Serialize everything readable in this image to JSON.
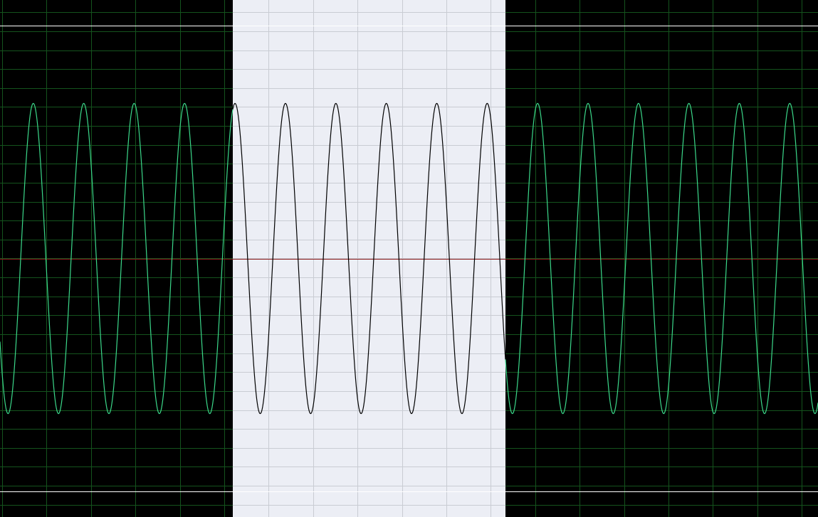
{
  "waveform_view": {
    "background_color": "#000000",
    "grid_color": "#14531d",
    "waveform_color": "#3bd88a",
    "center_line_color": "#8b1a1a",
    "clip_line_color": "#ffffff",
    "selection": {
      "start_fraction": 0.285,
      "end_fraction": 0.618,
      "background_color": "#eceef5",
      "grid_color": "#c9ccd3",
      "waveform_color": "#000000"
    },
    "signal": {
      "cycles_visible": 16.22,
      "phase_at_left_edge": -0.41,
      "peak_amplitude": 0.6,
      "clip_level": 0.9
    }
  }
}
